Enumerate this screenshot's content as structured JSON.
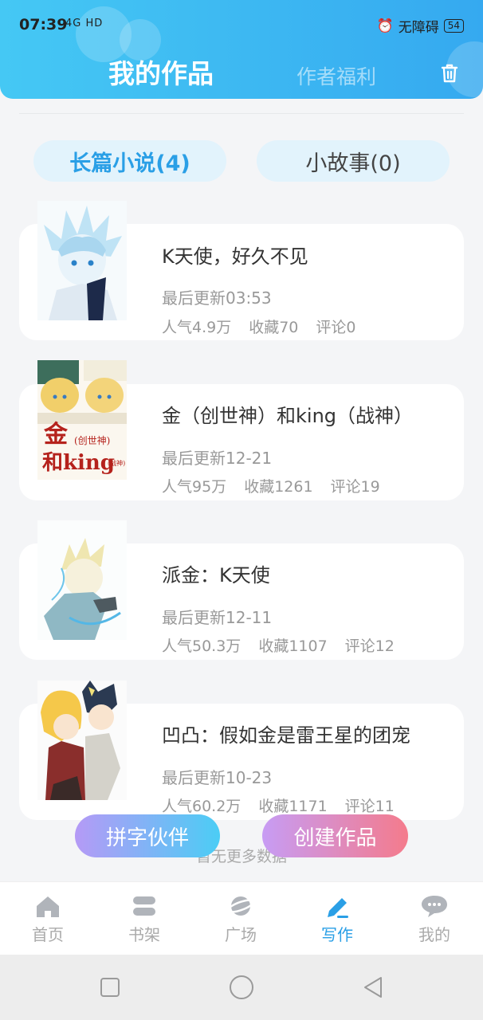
{
  "status_bar": {
    "time": "07:39",
    "signal_text": "4G HD",
    "accessibility": "无障碍",
    "battery": "54"
  },
  "header": {
    "title": "我的作品",
    "subtitle": "作者福利",
    "trash_icon": "trash-icon"
  },
  "tabs": [
    {
      "label": "长篇小说(4)",
      "active": true
    },
    {
      "label": "小故事(0)",
      "active": false
    }
  ],
  "books": [
    {
      "title": "K天使，好久不见",
      "updated": "最后更新03:53",
      "popularity": "人气4.9万",
      "favorites": "收藏70",
      "comments": "评论0"
    },
    {
      "title": "金（创世神）和king（战神）",
      "updated": "最后更新12-21",
      "popularity": "人气95万",
      "favorites": "收藏1261",
      "comments": "评论19",
      "cover_text_1": "金",
      "cover_text_2": "和king",
      "cover_small": "(创世神)",
      "cover_small_2": "(战神)"
    },
    {
      "title": "派金：K天使",
      "updated": "最后更新12-11",
      "popularity": "人气50.3万",
      "favorites": "收藏1107",
      "comments": "评论12"
    },
    {
      "title": "凹凸：假如金是雷王星的团宠",
      "updated": "最后更新10-23",
      "popularity": "人气60.2万",
      "favorites": "收藏1171",
      "comments": "评论11"
    }
  ],
  "no_more": "暂无更多数据",
  "fab": {
    "left": "拼字伙伴",
    "right": "创建作品"
  },
  "tabbar": [
    {
      "label": "首页",
      "icon": "home-icon",
      "active": false
    },
    {
      "label": "书架",
      "icon": "bookshelf-icon",
      "active": false
    },
    {
      "label": "广场",
      "icon": "planet-icon",
      "active": false
    },
    {
      "label": "写作",
      "icon": "pen-icon",
      "active": true
    },
    {
      "label": "我的",
      "icon": "chat-icon",
      "active": false
    }
  ],
  "colors": {
    "accent": "#2a9fe6",
    "header_gradient_start": "#45c8f4",
    "header_gradient_end": "#35a9f0",
    "tab_bg": "#e2f3fc"
  }
}
